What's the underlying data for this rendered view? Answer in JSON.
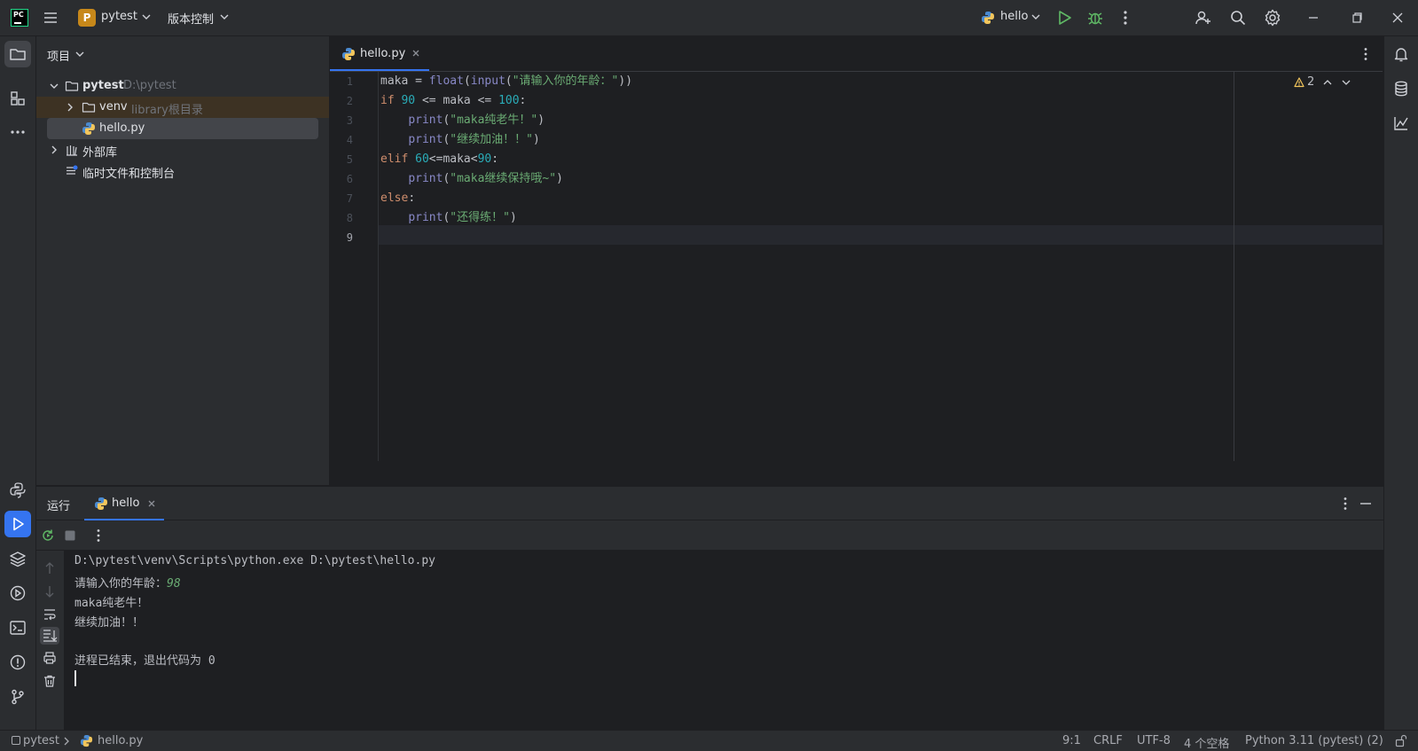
{
  "titlebar": {
    "project_badge": "P",
    "project_name": "pytest",
    "vcs_label": "版本控制",
    "run_config": "hello",
    "logo_text": "PC"
  },
  "project_panel": {
    "header": "项目",
    "tree": [
      {
        "label": "pytest",
        "hint": "D:\\pytest",
        "icon": "folder-icon"
      },
      {
        "label": "venv",
        "hint": "library根目录",
        "icon": "folder-icon"
      },
      {
        "label": "hello.py",
        "hint": "",
        "icon": "python-file-icon"
      },
      {
        "label": "外部库",
        "hint": "",
        "icon": "library-icon"
      },
      {
        "label": "临时文件和控制台",
        "hint": "",
        "icon": "scratch-icon"
      }
    ]
  },
  "editor": {
    "tab_label": "hello.py",
    "warnings_count": "2",
    "line_numbers": [
      "1",
      "2",
      "3",
      "4",
      "5",
      "6",
      "7",
      "8",
      "9"
    ],
    "current_line": "9"
  },
  "code": {
    "l1_var": "maka",
    "l1_eq": " = ",
    "l1_float": "float",
    "l1_paren1": "(",
    "l1_input": "input",
    "l1_paren2": "(",
    "l1_str": "\"请输入你的年龄：\"",
    "l1_close": "))",
    "l2_if": "if ",
    "l2_n1": "90",
    "l2_mid": " <= maka <= ",
    "l2_n2": "100",
    "l2_colon": ":",
    "l3_indent": "    ",
    "l3_print": "print",
    "l3_open": "(",
    "l3_str": "\"maka纯老牛！\"",
    "l3_close": ")",
    "l4_str": "\"继续加油！！\"",
    "l5_elif": "elif ",
    "l5_n1": "60",
    "l5_mid": "<=maka<",
    "l5_n2": "90",
    "l5_colon": ":",
    "l6_str": "\"maka继续保持哦~\"",
    "l7_else": "else",
    "l7_colon": ":",
    "l8_str": "\"还得练！\""
  },
  "run_panel": {
    "title": "运行",
    "tab_label": "hello",
    "console": {
      "command": "D:\\pytest\\venv\\Scripts\\python.exe D:\\pytest\\hello.py",
      "prompt": "请输入你的年龄：",
      "input_value": "98",
      "out1": "maka纯老牛！",
      "out2": "继续加油！！",
      "exit_msg": "进程已结束，退出代码为 0"
    }
  },
  "statusbar": {
    "breadcrumb_project": "pytest",
    "breadcrumb_file": "hello.py",
    "position": "9:1",
    "line_ending": "CRLF",
    "encoding": "UTF-8",
    "indent": "4 个空格",
    "interpreter": "Python 3.11 (pytest) (2)"
  },
  "colors": {
    "accent": "#3574f0",
    "keyword": "#cf8e6d",
    "number": "#2aacb8",
    "string": "#6aab73",
    "builtin": "#8888c6",
    "run_green": "#5fb865",
    "warning": "#f2c55c"
  }
}
